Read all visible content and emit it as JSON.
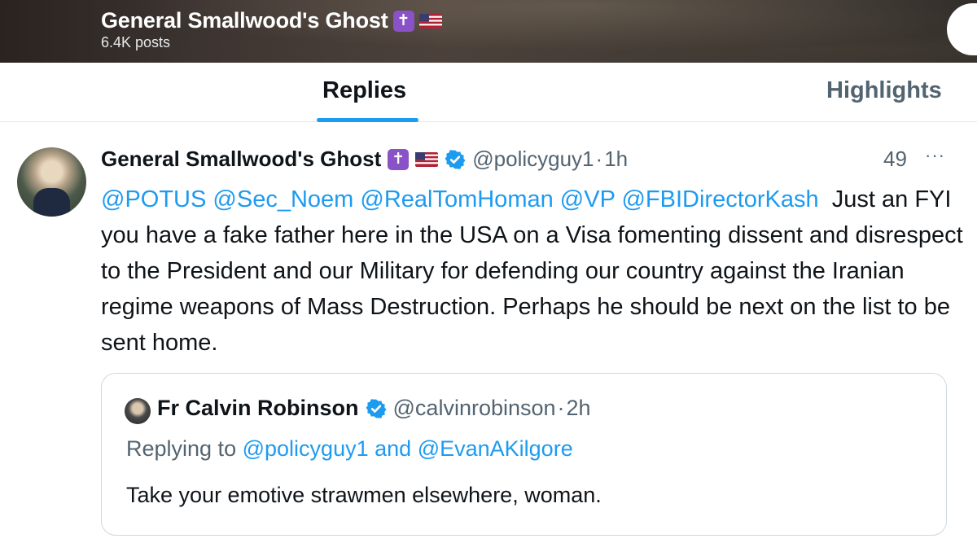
{
  "header": {
    "title": "General Smallwood's Ghost",
    "title_badge": "✝",
    "post_count": "6.4K posts"
  },
  "tabs": [
    {
      "label": "Replies",
      "active": true
    },
    {
      "label": "Highlights",
      "active": false
    }
  ],
  "post": {
    "author_name": "General Smallwood's Ghost",
    "badge": "✝",
    "handle": "@policyguy1",
    "separator": "·",
    "time": "1h",
    "views": "49",
    "more": "···",
    "mentions": [
      "@POTUS",
      "@Sec_Noem",
      "@RealTomHoman",
      "@VP",
      "@FBIDirectorKash"
    ],
    "text": "Just an FYI you have a fake father here in the USA on a Visa fomenting dissent and disrespect to the President and our Military  for defending our country against the Iranian regime weapons of Mass Destruction. Perhaps he should be next on the list to be sent home."
  },
  "quote": {
    "author_name": "Fr Calvin Robinson",
    "handle": "@calvinrobinson",
    "separator": "·",
    "time": "2h",
    "replying_prefix": "Replying to",
    "replying_to_1": "@policyguy1",
    "replying_and": "and",
    "replying_to_2": "@EvanAKilgore",
    "text": "Take your emotive strawmen elsewhere, woman."
  },
  "colors": {
    "accent": "#1d9bf0",
    "secondary_text": "#536471",
    "badge_purple": "#8a52c7"
  },
  "icons": [
    "cross-icon",
    "us-flag-icon",
    "verified-badge-icon",
    "more-icon"
  ]
}
